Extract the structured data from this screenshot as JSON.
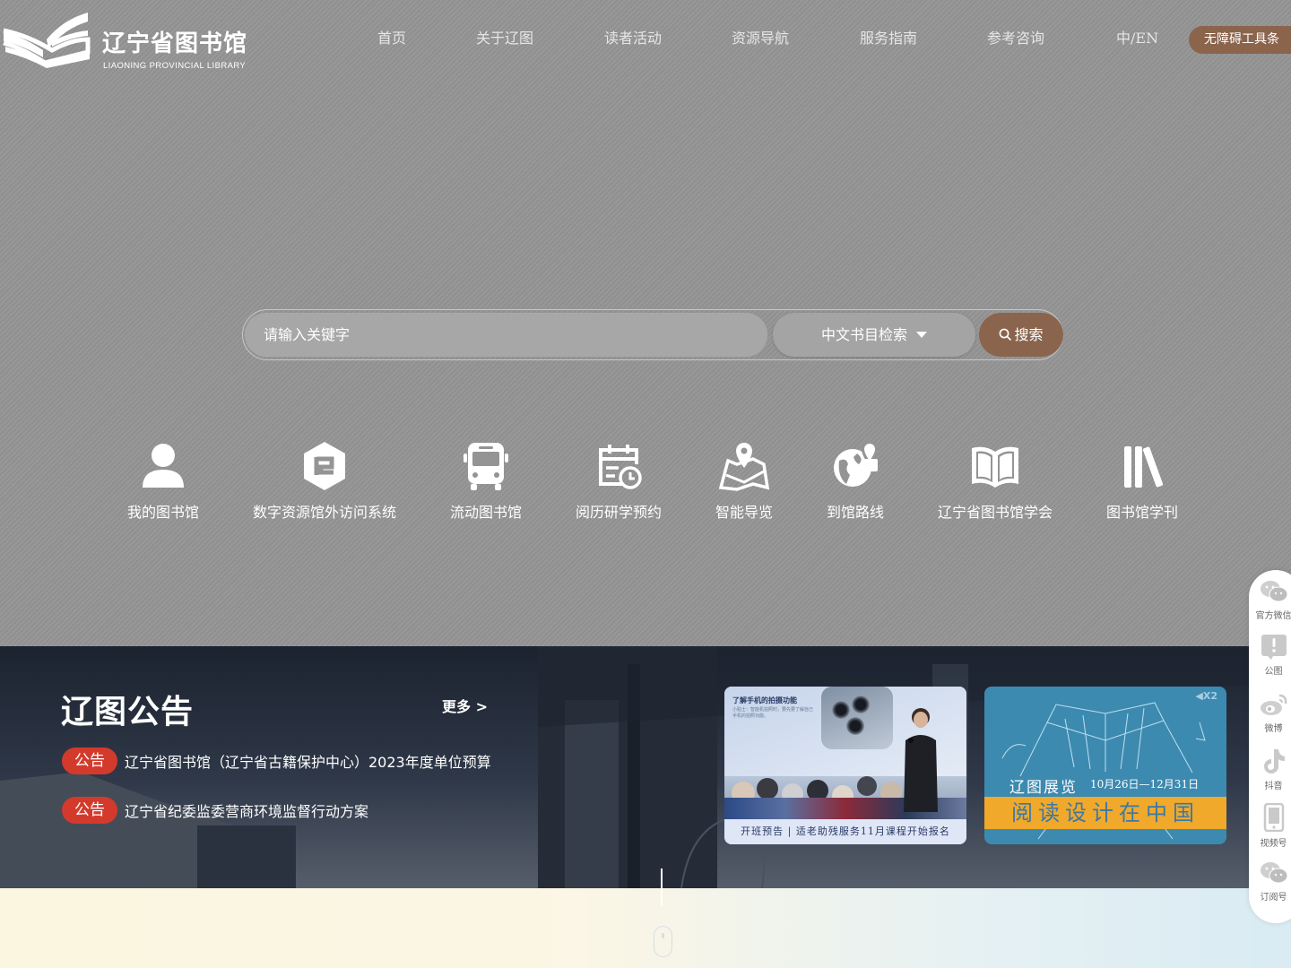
{
  "header": {
    "logo_cn": "辽宁省图书馆",
    "logo_en": "LIAONING PROVINCIAL LIBRARY",
    "nav": [
      "首页",
      "关于辽图",
      "读者活动",
      "资源导航",
      "服务指南",
      "参考咨询"
    ],
    "lang": "中/EN",
    "accessibility": "无障碍工具条"
  },
  "search": {
    "placeholder": "请输入关键字",
    "type": "中文书目检索",
    "button": "搜索"
  },
  "quick_links": [
    "我的图书馆",
    "数字资源馆外访问系统",
    "流动图书馆",
    "阅历研学预约",
    "智能导览",
    "到馆路线",
    "辽宁省图书馆学会",
    "图书馆学刊"
  ],
  "notices": {
    "title": "辽图公告",
    "more": "更多 >",
    "items": [
      {
        "tag": "公告",
        "text": "辽宁省图书馆（辽宁省古籍保护中心）2023年度单位预算"
      },
      {
        "tag": "公告",
        "text": "辽宁省纪委监委营商环境监督行动方案"
      }
    ]
  },
  "cards": [
    {
      "title": "了解手机的拍摄功能",
      "subtitle": "小贴士：智能机拍照时，要先要了解自己手机的拍照功能。",
      "caption": "开班预告 | 适老助残服务11月课程开始报名"
    },
    {
      "label": "辽图展览",
      "dates": "10月26日—12月31日",
      "headline": "阅读设计在中国",
      "badge": "◀X2"
    }
  ],
  "side": [
    "官方微信",
    "公图",
    "微博",
    "抖音",
    "视频号",
    "订阅号"
  ],
  "colors": {
    "accent_brown": "#8a644d",
    "tag_red": "#d33a2c",
    "hero_gray": "#949494"
  }
}
